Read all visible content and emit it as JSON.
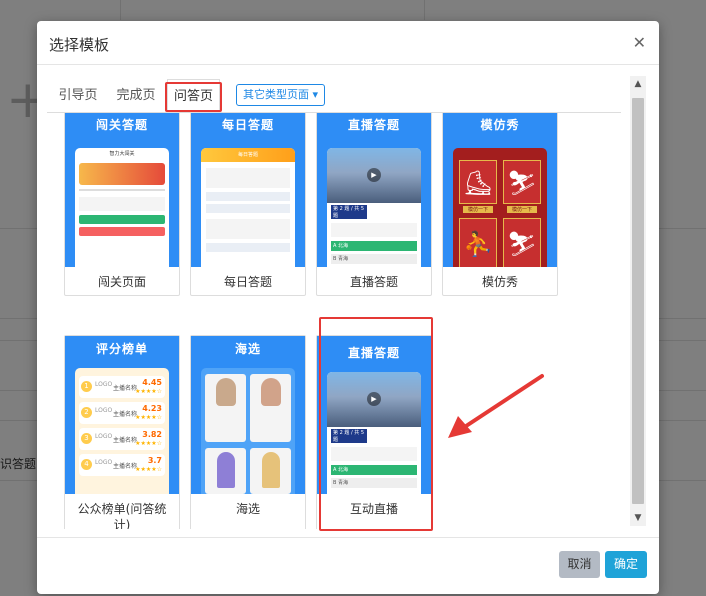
{
  "background": {
    "cut_text": "识答题"
  },
  "modal": {
    "title": "选择模板",
    "close_icon": "close-icon"
  },
  "tabs": [
    {
      "label": "引导页"
    },
    {
      "label": "完成页"
    },
    {
      "label": "问答页",
      "active": true
    }
  ],
  "type_dropdown": {
    "label": "其它类型页面",
    "caret": "▾"
  },
  "templates": [
    {
      "thumb_title": "闯关答题",
      "label": "闯关页面"
    },
    {
      "thumb_title": "每日答题",
      "label": "每日答题"
    },
    {
      "thumb_title": "直播答题",
      "label": "直播答题"
    },
    {
      "thumb_title": "模仿秀",
      "label": "模仿秀"
    },
    {
      "thumb_title": "评分榜单",
      "label": "公众榜单(问答统计)"
    },
    {
      "thumb_title": "海选",
      "label": "海选"
    },
    {
      "thumb_title": "直播答题",
      "label": "互动直播"
    }
  ],
  "thumb_text": {
    "chuangguan_header": "智力大闯关",
    "meiri_banner": "每日答题",
    "live_question_no": "第 2 题 / 共 5 题",
    "live_option_a": "A 北海",
    "live_option_b": "B 青海",
    "rank_logo": "LOGO",
    "rank_scores": [
      "4.45",
      "4.23",
      "3.82",
      "3.7"
    ],
    "rank_names": [
      "主播名称",
      "主播名称",
      "主播名称",
      "主播名称"
    ],
    "imitation_buttons": [
      "模仿一下",
      "模仿一下"
    ]
  },
  "buttons": {
    "cancel": "取消",
    "ok": "确定"
  },
  "scroll_icons": {
    "up": "▲",
    "down": "▼"
  },
  "colors": {
    "accent": "#1fa3d8",
    "thumb_blue": "#2e8df5",
    "highlight_red": "#e53935"
  }
}
